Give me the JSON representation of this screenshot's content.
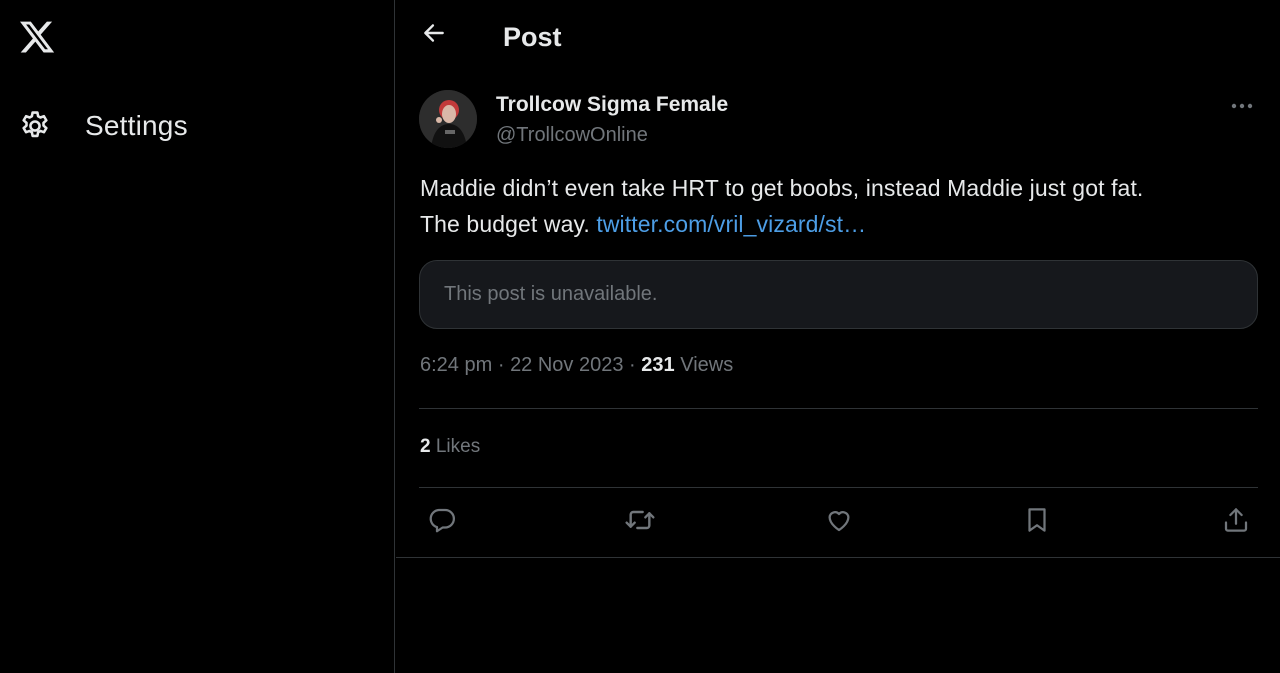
{
  "sidebar": {
    "logo_icon": "x-logo-icon",
    "items": [
      {
        "label": "Settings",
        "icon": "gear-icon"
      }
    ]
  },
  "header": {
    "title": "Post",
    "back_icon": "arrow-left-icon"
  },
  "post": {
    "author_name": "Trollcow Sigma Female",
    "author_handle": "@TrollcowOnline",
    "text_line1": "Maddie didn’t even take HRT to get boobs, instead Maddie just got fat.",
    "text_line2": "The budget way.",
    "link_text": "twitter.com/vril_vizard/st…",
    "quoted_unavailable": "This post is unavailable.",
    "time": "6:24 pm",
    "date": "22 Nov 2023",
    "separator": "·",
    "views_count": "231",
    "views_label": "Views",
    "likes_count": "2",
    "likes_label": "Likes"
  },
  "actions": [
    "reply-icon",
    "repost-icon",
    "like-icon",
    "bookmark-icon",
    "share-icon"
  ],
  "colors": {
    "background": "#000000",
    "text": "#e7e9ea",
    "secondary": "#71767b",
    "link": "#4d9ee6",
    "border": "#2f3336"
  }
}
